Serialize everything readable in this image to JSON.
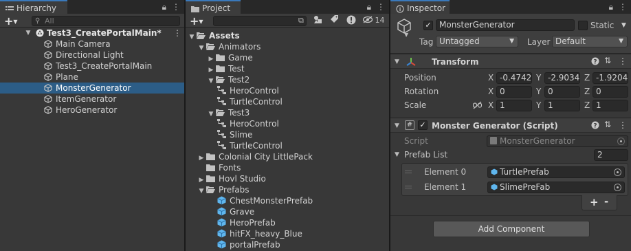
{
  "hierarchy": {
    "tab_label": "Hierarchy",
    "search_placeholder": "All",
    "scene_name": "Test3_CreatePortalMain*",
    "items": [
      {
        "label": "Main Camera",
        "selected": false
      },
      {
        "label": "Directional Light",
        "selected": false
      },
      {
        "label": "Test3_CreatePortalMain",
        "selected": false
      },
      {
        "label": "Plane",
        "selected": false
      },
      {
        "label": "MonsterGenerator",
        "selected": true
      },
      {
        "label": "ItemGenerator",
        "selected": false
      },
      {
        "label": "HeroGenerator",
        "selected": false
      }
    ]
  },
  "project": {
    "tab_label": "Project",
    "hidden_count": "14",
    "tree": {
      "assets": "Assets",
      "animators": "Animators",
      "game": "Game",
      "test": "Test",
      "test2": "Test2",
      "test2_children": [
        "HeroControl",
        "TurtleControl"
      ],
      "test3": "Test3",
      "test3_children": [
        "HeroControl",
        "Slime",
        "TurtleControl"
      ],
      "colonial": "Colonial City LittlePack",
      "fonts": "Fonts",
      "hovl": "Hovl Studio",
      "prefabs": "Prefabs",
      "prefab_children": [
        "ChestMonsterPrefab",
        "Grave",
        "HeroPrefab",
        "hitFX_heavy_Blue",
        "portalPrefab"
      ]
    }
  },
  "inspector": {
    "tab_label": "Inspector",
    "object_name": "MonsterGenerator",
    "static_label": "Static",
    "tag_label": "Tag",
    "tag_value": "Untagged",
    "layer_label": "Layer",
    "layer_value": "Default",
    "transform": {
      "title": "Transform",
      "position_label": "Position",
      "rotation_label": "Rotation",
      "scale_label": "Scale",
      "axis_x": "X",
      "axis_y": "Y",
      "axis_z": "Z",
      "position": [
        "-0.4742",
        "-2.9034",
        "-1.9204"
      ],
      "rotation": [
        "0",
        "0",
        "0"
      ],
      "scale": [
        "1",
        "1",
        "1"
      ]
    },
    "script_component": {
      "title": "Monster Generator (Script)",
      "script_label": "Script",
      "script_value": "MonsterGenerator",
      "prefab_list_label": "Prefab List",
      "prefab_list_count": "2",
      "elements": [
        {
          "label": "Element 0",
          "value": "TurtlePrefab"
        },
        {
          "label": "Element 1",
          "value": "SlimePreFab"
        }
      ],
      "plus": "+",
      "minus": "-"
    },
    "add_component": "Add Component"
  }
}
